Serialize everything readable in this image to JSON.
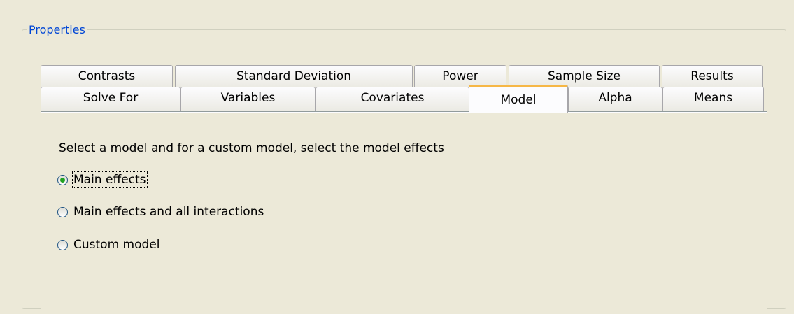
{
  "properties": {
    "group_title": "Properties",
    "tabs_row1": [
      "Contrasts",
      "Standard Deviation",
      "Power",
      "Sample Size",
      "Results"
    ],
    "tabs_row2": [
      "Solve For",
      "Variables",
      "Covariates",
      "Model",
      "Alpha",
      "Means"
    ],
    "selected_tab": "Model"
  },
  "model_panel": {
    "instructions": "Select a model and for a custom model, select the model effects",
    "options": [
      {
        "label": "Main effects",
        "selected": true
      },
      {
        "label": "Main effects and all interactions",
        "selected": false
      },
      {
        "label": "Custom model",
        "selected": false
      }
    ]
  },
  "colors": {
    "background": "#ece9d8",
    "group_title": "#0046d5",
    "selected_tab_accent": "#f6b745",
    "radio_checked_dot": "#21a121"
  }
}
